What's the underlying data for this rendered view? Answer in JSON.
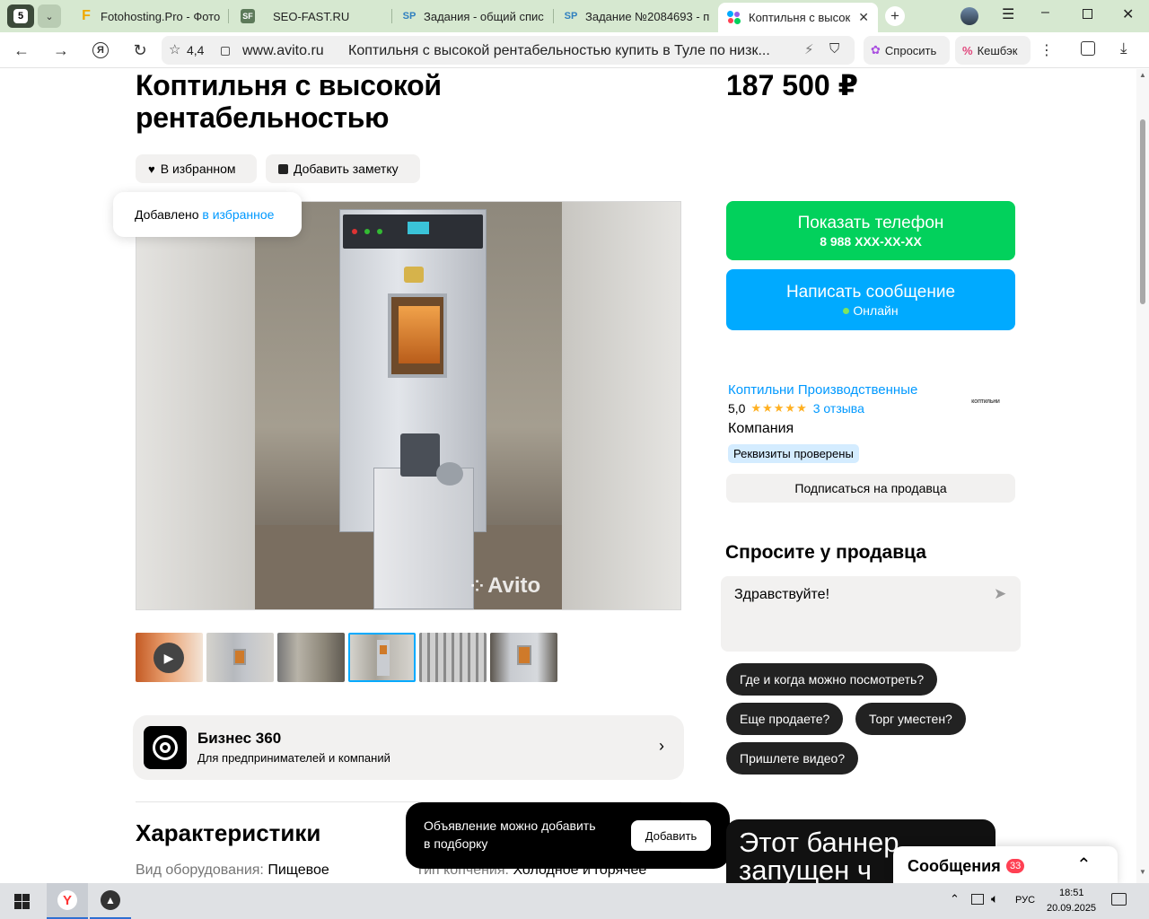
{
  "browser": {
    "tab_counter": "5",
    "tabs": [
      {
        "label": "Fotohosting.Pro - Фото",
        "icon": "F"
      },
      {
        "label": "SEO-FAST.RU",
        "icon": "SF"
      },
      {
        "label": "Задания - общий спис",
        "icon": "SP"
      },
      {
        "label": "Задание №2084693 - п",
        "icon": "SP"
      },
      {
        "label": "Коптильня с высоко",
        "icon": "avito-icon"
      }
    ],
    "rating": "4,4",
    "domain": "www.avito.ru",
    "page_title": "Коптильня с высокой рентабельностью купить в Туле по низк...",
    "ask_label": "Спросить",
    "cashback_label": "Кешбэк"
  },
  "listing": {
    "title": "Коптильня с высокой рентабельностью",
    "price": "187 500 ₽",
    "favorite_label": "В избранном",
    "note_label": "Добавить заметку",
    "tooltip_text": "Добавлено ",
    "tooltip_link": "в избранное",
    "watermark": "Avito"
  },
  "contact": {
    "phone_label": "Показать телефон",
    "phone_number": "8 988 XXX-XX-XX",
    "message_label": "Написать сообщение",
    "online_label": "Онлайн"
  },
  "seller": {
    "name": "Коптильни Производственные",
    "rating": "5,0",
    "stars": 5,
    "reviews": "3 отзыва",
    "type": "Компания",
    "verified": "Реквизиты проверены",
    "subscribe": "Подписаться на продавца",
    "logo_text": "КОПТИЛЬНИ"
  },
  "ask_seller": {
    "heading": "Спросите у продавца",
    "message": "Здравствуйте!",
    "questions": [
      "Где и когда можно посмотреть?",
      "Еще продаете?",
      "Торг уместен?",
      "Пришлете видео?"
    ]
  },
  "business": {
    "title": "Бизнес 360",
    "subtitle": "Для предпринимателей и компаний"
  },
  "specs": {
    "heading": "Характеристики",
    "items": [
      {
        "key": "Вид оборудования:",
        "value": "Пищевое"
      },
      {
        "key": "Тип копчения:",
        "value": "Холодное и горячее"
      }
    ]
  },
  "toast": {
    "text_line1": "Объявление можно добавить",
    "text_line2": "в подборку",
    "button": "Добавить"
  },
  "banner_text": "Этот баннер запущен ч",
  "messages": {
    "label": "Сообщения",
    "count": "33"
  },
  "taskbar": {
    "lang": "РУС",
    "time": "18:51",
    "date": "20.09.2025"
  },
  "colors": {
    "green": "#02d15c",
    "blue": "#00aaff",
    "link": "#0099ff",
    "star": "#ffb021"
  }
}
